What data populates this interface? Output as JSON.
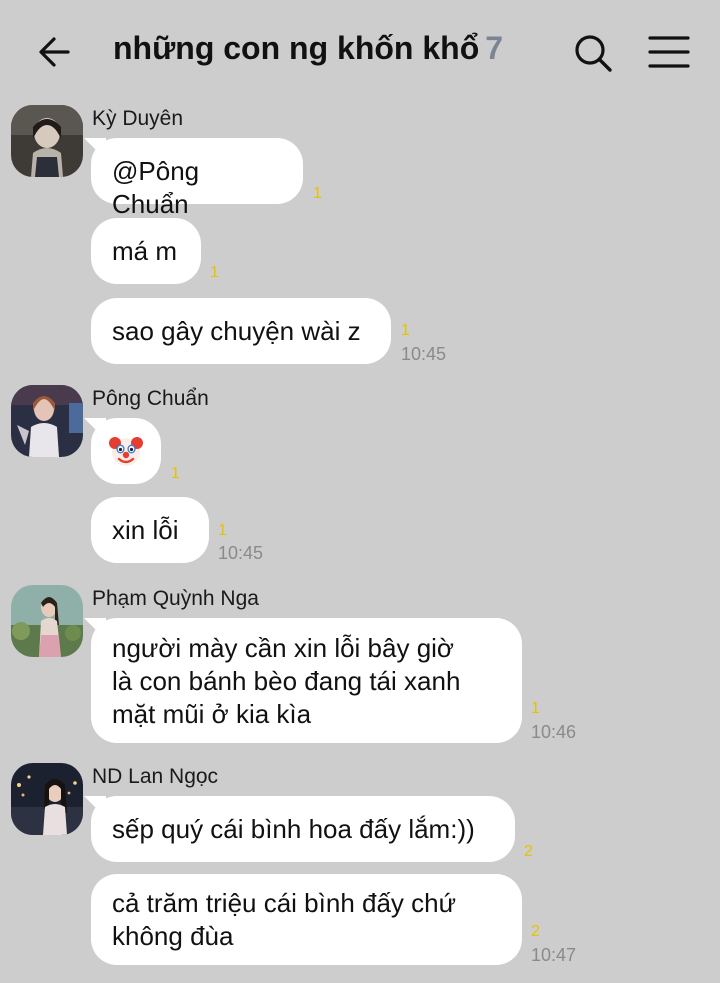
{
  "header": {
    "title": "những con ng khốn khổ",
    "member_count": "7",
    "icons": {
      "back": "back-arrow-icon",
      "search": "search-icon",
      "menu": "hamburger-menu-icon"
    }
  },
  "messages": [
    {
      "sender": "Kỳ Duyên",
      "bubbles": [
        {
          "text": "@Pông Chuẩn",
          "receipt": "1"
        },
        {
          "text": "má m",
          "receipt": "1"
        },
        {
          "text": "sao gây chuyện wài z",
          "receipt": "1",
          "time": "10:45"
        }
      ]
    },
    {
      "sender": "Pông Chuẩn",
      "bubbles": [
        {
          "emoji": "clown-face",
          "receipt": "1"
        },
        {
          "text": "xin lỗi",
          "receipt": "1",
          "time": "10:45"
        }
      ]
    },
    {
      "sender": "Phạm Quỳnh Nga",
      "bubbles": [
        {
          "lines": [
            "người mày cần xin lỗi bây giờ",
            "là con bánh bèo đang tái xanh",
            "mặt mũi ở kia kìa"
          ],
          "receipt": "1",
          "time": "10:46"
        }
      ]
    },
    {
      "sender": "ND Lan Ngọc",
      "bubbles": [
        {
          "text": "sếp quý cái bình hoa đấy lắm:))",
          "receipt": "2"
        },
        {
          "lines": [
            "cả trăm triệu cái bình đấy chứ",
            "không đùa"
          ],
          "receipt": "2",
          "time": "10:47"
        }
      ]
    }
  ],
  "colors": {
    "background": "#cdcdcd",
    "bubble": "#ffffff",
    "receipt": "#e6c200",
    "time": "#8a8a8a",
    "count": "#7a8591"
  }
}
